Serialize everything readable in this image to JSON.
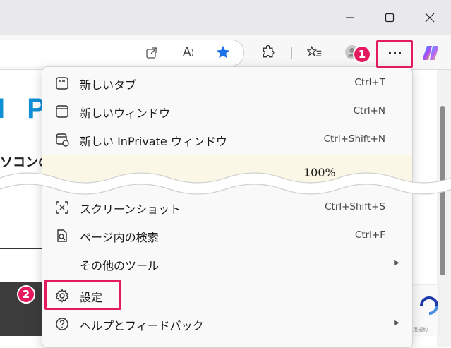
{
  "window": {
    "minimize_icon": "minimize-icon",
    "maximize_icon": "maximize-icon",
    "close_icon": "close-icon"
  },
  "toolbar": {
    "more_label": "···",
    "icons": [
      "open-in-app-icon",
      "read-aloud-icon",
      "favorite-star-icon",
      "extensions-icon",
      "favorites-icon",
      "profile-icon",
      "copilot-icon"
    ],
    "accent": "#1a73e8"
  },
  "page": {
    "brand": "I P",
    "text": "ソコンの"
  },
  "menu": {
    "items_top": [
      {
        "label": "新しいタブ",
        "shortcut": "Ctrl+T",
        "icon": "new-tab-icon"
      },
      {
        "label": "新しいウィンドウ",
        "shortcut": "Ctrl+N",
        "icon": "new-window-icon"
      },
      {
        "label": "新しい InPrivate ウィンドウ",
        "shortcut": "Ctrl+Shift+N",
        "icon": "inprivate-icon"
      }
    ],
    "zoom_value": "100%",
    "items_bottom": [
      {
        "label": "スクリーンショット",
        "shortcut": "Ctrl+Shift+S",
        "icon": "screenshot-icon"
      },
      {
        "label": "ページ内の検索",
        "shortcut": "Ctrl+F",
        "icon": "find-icon"
      },
      {
        "label": "その他のツール",
        "shortcut": "",
        "icon": ""
      },
      {
        "label": "設定",
        "shortcut": "",
        "icon": "settings-gear-icon"
      },
      {
        "label": "ヘルプとフィードバック",
        "shortcut": "",
        "icon": "help-icon"
      }
    ]
  },
  "annotations": {
    "step1": "1",
    "step2": "2",
    "color": "#e5195f"
  },
  "recaptcha_text": "利用規約"
}
